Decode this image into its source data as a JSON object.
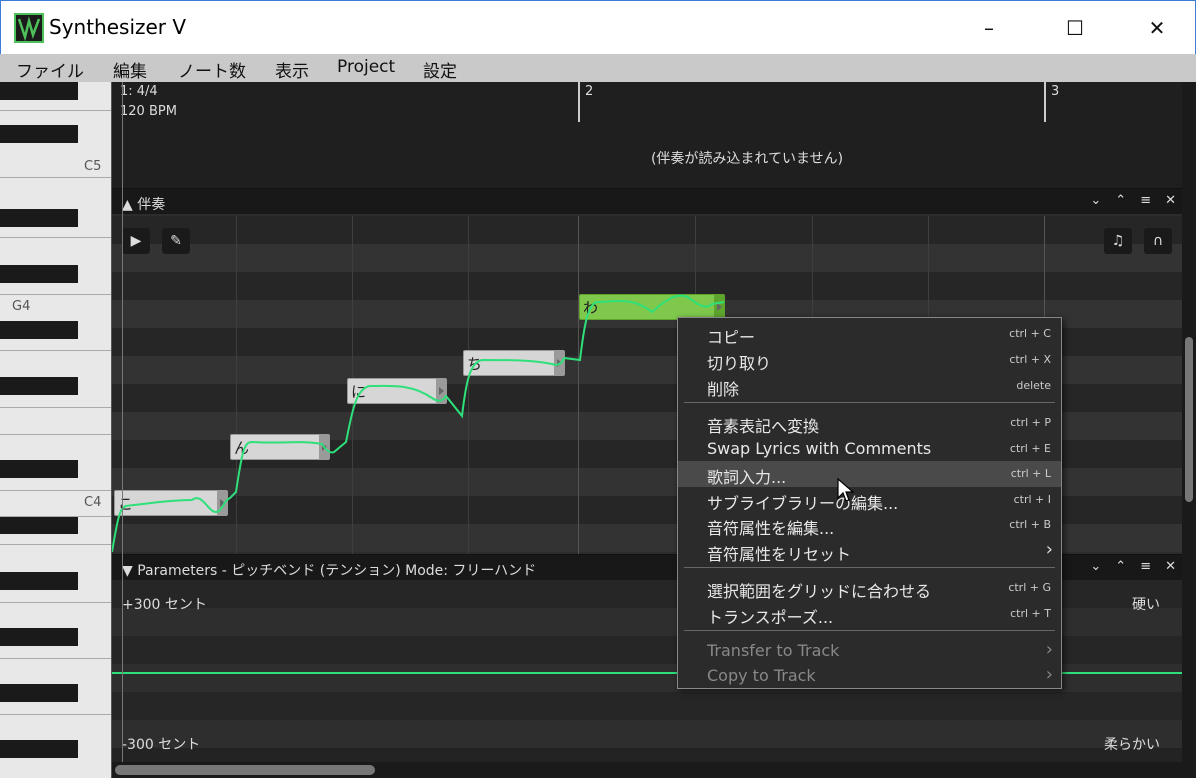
{
  "window": {
    "title": "Synthesizer V",
    "controls": [
      "–",
      "☐",
      "✕"
    ]
  },
  "menu": [
    "ファイル",
    "編集",
    "ノート数",
    "表示",
    "Project",
    "設定"
  ],
  "piano": {
    "label_c5": "C5",
    "label_g4": "G4",
    "label_c4": "C4"
  },
  "ruler": {
    "time_signature": "1: 4/4",
    "tempo": "120 BPM",
    "bar2": "2",
    "bar3": "3",
    "accompaniment_message": "(伴奏が読み込まれていません)"
  },
  "accompaniment_panel": {
    "title": "伴奏",
    "controls": [
      "⌄",
      "⌃",
      "≡",
      "✕"
    ]
  },
  "notes": [
    {
      "lyric": "こ",
      "selected": false
    },
    {
      "lyric": "ん",
      "selected": false
    },
    {
      "lyric": "に",
      "selected": false
    },
    {
      "lyric": "ち",
      "selected": false
    },
    {
      "lyric": "わ",
      "selected": true
    }
  ],
  "parameters_panel": {
    "title": "Parameters - ピッチベンド (テンション) Mode: フリーハンド",
    "controls": [
      "⌄",
      "⌃",
      "≡",
      "✕"
    ],
    "top_label": "+300 セント",
    "bottom_label": "-300 セント",
    "right_top_label": "硬い",
    "right_bottom_label": "柔らかい"
  },
  "context_menu": {
    "items": [
      {
        "label": "コピー",
        "shortcut": "ctrl + C"
      },
      {
        "label": "切り取り",
        "shortcut": "ctrl + X"
      },
      {
        "label": "削除",
        "shortcut": "delete"
      },
      {
        "label": "音素表記へ変換",
        "shortcut": "ctrl + P"
      },
      {
        "label": "Swap Lyrics with Comments",
        "shortcut": "ctrl + E"
      },
      {
        "label": "歌詞入力...",
        "shortcut": "ctrl + L"
      },
      {
        "label": "サブライブラリーの編集...",
        "shortcut": "ctrl + I"
      },
      {
        "label": "音符属性を編集...",
        "shortcut": "ctrl + B"
      },
      {
        "label": "音符属性をリセット",
        "shortcut": ""
      },
      {
        "label": "選択範囲をグリッドに合わせる",
        "shortcut": "ctrl + G"
      },
      {
        "label": "トランスポーズ...",
        "shortcut": "ctrl + T"
      },
      {
        "label": "Transfer to Track",
        "shortcut": ""
      },
      {
        "label": "Copy to Track",
        "shortcut": ""
      }
    ]
  },
  "colors": {
    "accent_green": "#2ee07a",
    "selected_note": "#7fc84b"
  }
}
